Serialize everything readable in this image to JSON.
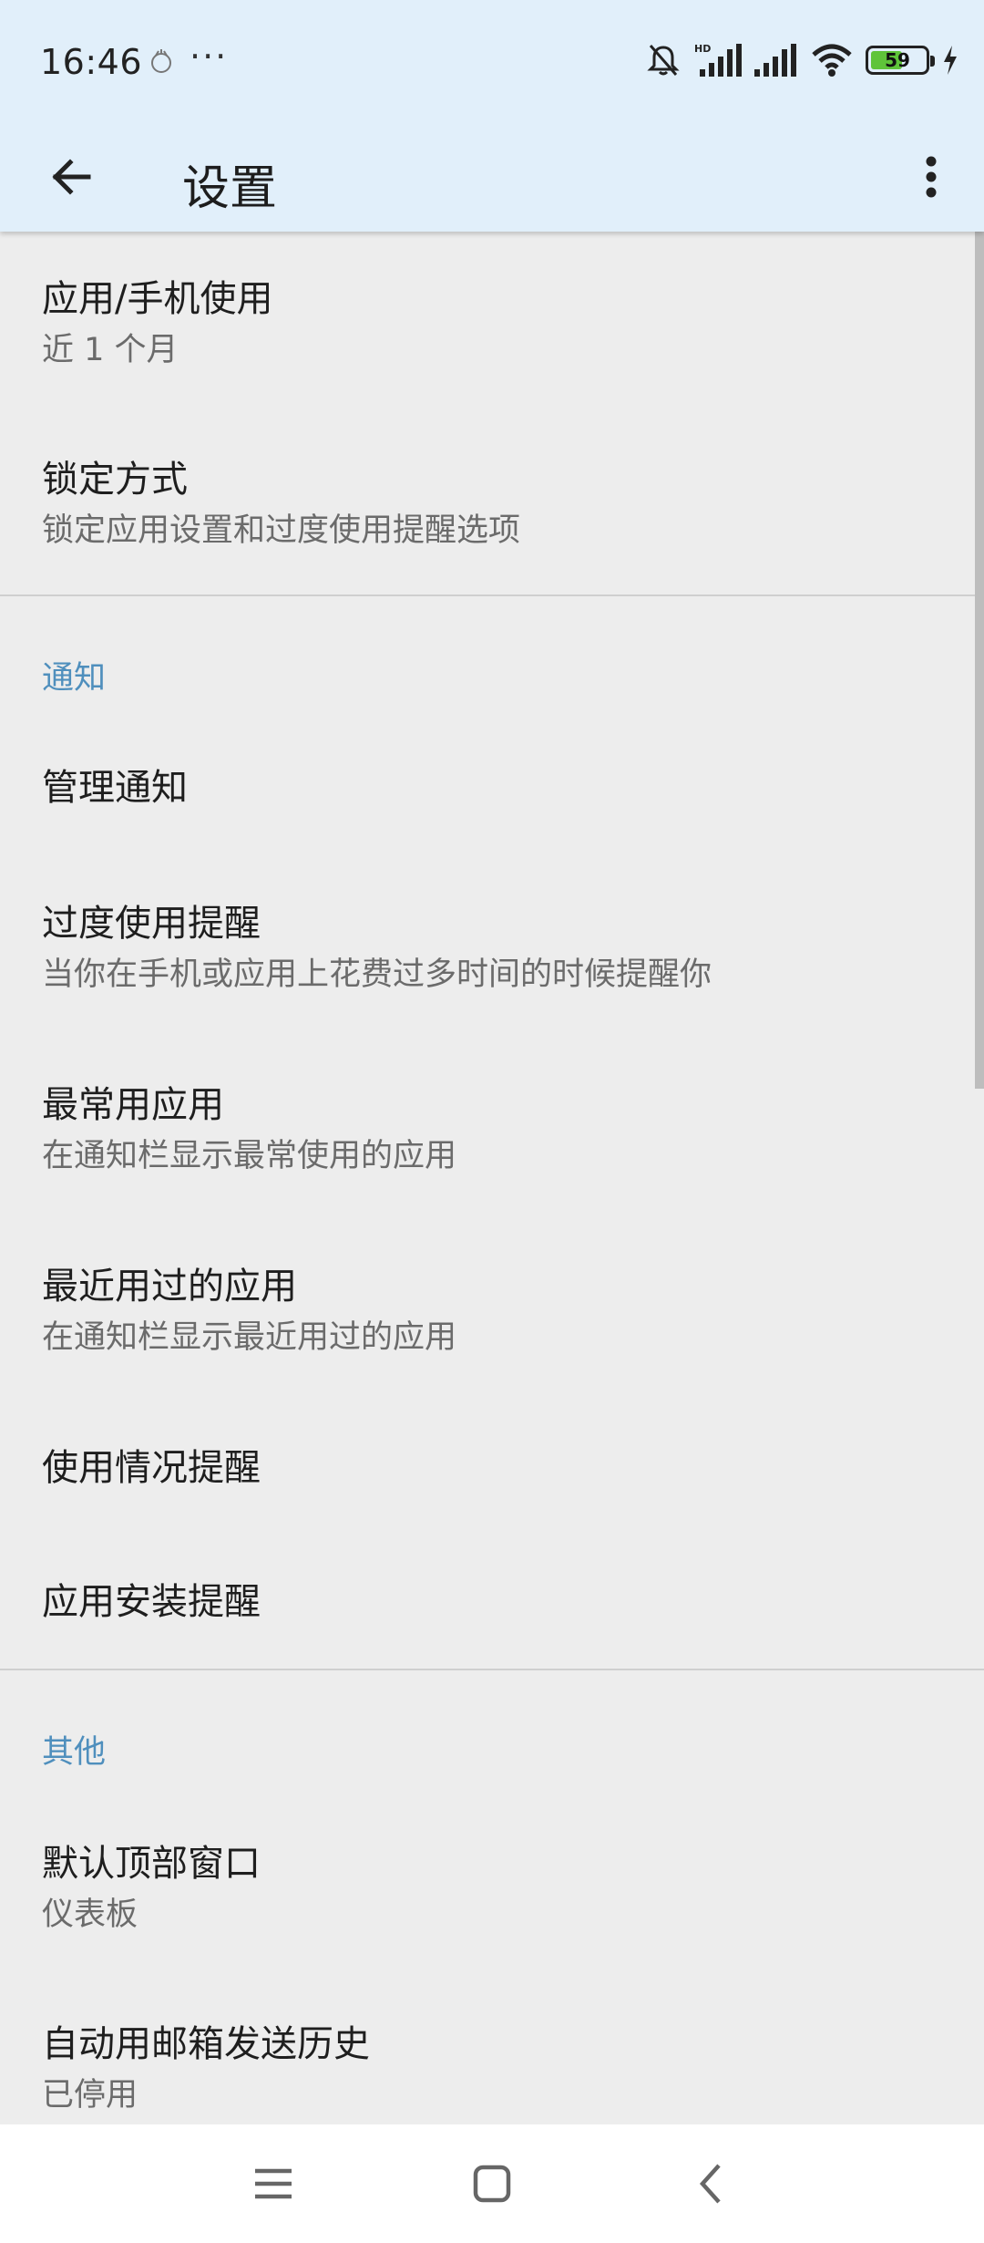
{
  "status_bar": {
    "time": "16:46",
    "more": "···",
    "battery_level": "59",
    "battery_fraction": 0.59,
    "icons": [
      "app-notification-icon",
      "mute-icon",
      "hd-signal-icon",
      "signal-icon",
      "wifi-icon",
      "battery-icon",
      "charging-icon"
    ]
  },
  "app_bar": {
    "title": "设置"
  },
  "items": [
    {
      "title": "应用/手机使用",
      "subtitle": "近 1 个月"
    },
    {
      "title": "锁定方式",
      "subtitle": "锁定应用设置和过度使用提醒选项"
    }
  ],
  "sections": [
    {
      "header": "通知",
      "items": [
        {
          "title": "管理通知"
        },
        {
          "title": "过度使用提醒",
          "subtitle": "当你在手机或应用上花费过多时间的时候提醒你"
        },
        {
          "title": "最常用应用",
          "subtitle": "在通知栏显示最常使用的应用"
        },
        {
          "title": "最近用过的应用",
          "subtitle": "在通知栏显示最近用过的应用"
        },
        {
          "title": "使用情况提醒"
        },
        {
          "title": "应用安装提醒"
        }
      ]
    },
    {
      "header": "其他",
      "items": [
        {
          "title": "默认顶部窗口",
          "subtitle": "仪表板"
        },
        {
          "title": "自动用邮箱发送历史",
          "subtitle": "已停用"
        }
      ]
    }
  ],
  "colors": {
    "header_bg": "#e1effa",
    "section_header": "#4f8fbd",
    "list_bg": "#ededed",
    "battery_fill": "#5fc43a"
  }
}
